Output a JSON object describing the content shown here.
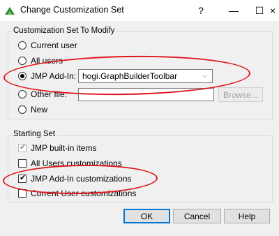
{
  "window": {
    "title": "Change Customization Set",
    "help_glyph": "?",
    "minimize_glyph": "—",
    "maximize_glyph": "☐",
    "close_glyph": "×"
  },
  "modify_group": {
    "title": "Customization Set To Modify",
    "options": [
      {
        "label": "Current user",
        "selected": false
      },
      {
        "label": "All users",
        "selected": false
      },
      {
        "label": "JMP Add-In:",
        "selected": true
      },
      {
        "label": "Other file:",
        "selected": false
      },
      {
        "label": "New",
        "selected": false
      }
    ],
    "addin_select_value": "hogi.GraphBuilderToolbar",
    "other_file_value": "",
    "browse_label": "Browse..."
  },
  "starting_group": {
    "title": "Starting Set",
    "items": [
      {
        "label": "JMP built-in items",
        "checked": true,
        "enabled": false
      },
      {
        "label": "All Users customizations",
        "checked": false,
        "enabled": true
      },
      {
        "label": "JMP Add-In customizations",
        "checked": true,
        "enabled": true
      },
      {
        "label": "Current User customizations",
        "checked": false,
        "enabled": true
      }
    ]
  },
  "buttons": {
    "ok": "OK",
    "cancel": "Cancel",
    "help": "Help"
  },
  "check_glyph": "✔",
  "colors": {
    "annotation": "#e0161d",
    "default_button_border": "#0078d7"
  }
}
